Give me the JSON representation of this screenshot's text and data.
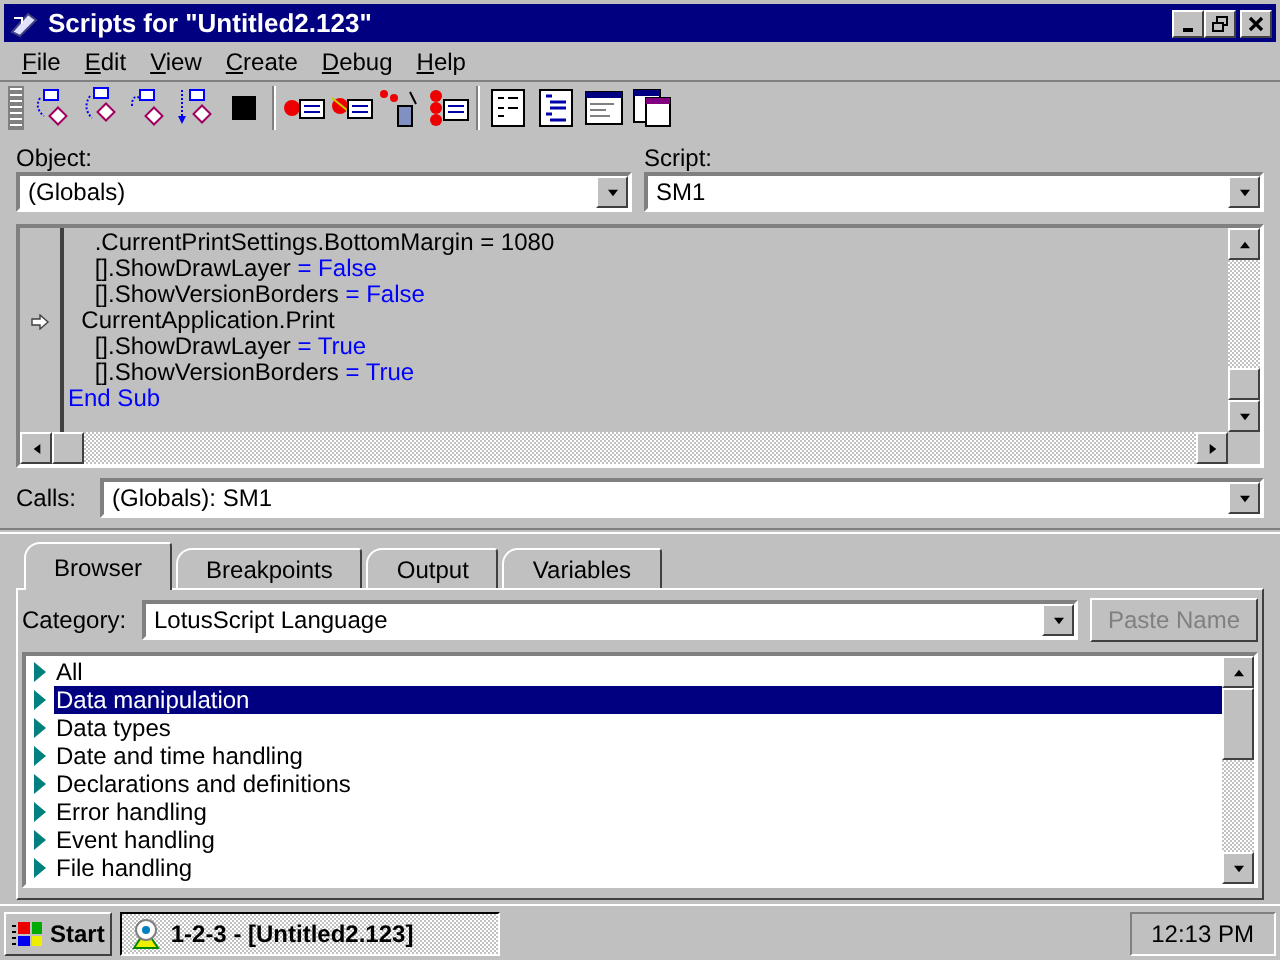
{
  "window": {
    "title": "Scripts for \"Untitled2.123\""
  },
  "menu": [
    "File",
    "Edit",
    "View",
    "Create",
    "Debug",
    "Help"
  ],
  "object": {
    "label": "Object:",
    "value": "(Globals)"
  },
  "script": {
    "label": "Script:",
    "value": "SM1"
  },
  "code": [
    {
      "current": false,
      "segments": [
        {
          "kind": "plain",
          "text": "    .CurrentPrintSettings.BottomMargin = 1080"
        }
      ]
    },
    {
      "current": false,
      "segments": [
        {
          "kind": "plain",
          "text": "    [].ShowDrawLayer "
        },
        {
          "kind": "keyword",
          "text": "= False"
        }
      ]
    },
    {
      "current": false,
      "segments": [
        {
          "kind": "plain",
          "text": "    [].ShowVersionBorders "
        },
        {
          "kind": "keyword",
          "text": "= False"
        }
      ]
    },
    {
      "current": true,
      "segments": [
        {
          "kind": "plain",
          "text": "  CurrentApplication.Print"
        }
      ]
    },
    {
      "current": false,
      "segments": [
        {
          "kind": "plain",
          "text": "    [].ShowDrawLayer "
        },
        {
          "kind": "keyword",
          "text": "= True"
        }
      ]
    },
    {
      "current": false,
      "segments": [
        {
          "kind": "plain",
          "text": "    [].ShowVersionBorders "
        },
        {
          "kind": "keyword",
          "text": "= True"
        }
      ]
    },
    {
      "current": false,
      "segments": [
        {
          "kind": "keyword",
          "text": "End Sub"
        }
      ]
    }
  ],
  "calls": {
    "label": "Calls:",
    "value": "(Globals): SM1"
  },
  "tabs": [
    {
      "label": "Browser",
      "selected": true
    },
    {
      "label": "Breakpoints",
      "selected": false
    },
    {
      "label": "Output",
      "selected": false
    },
    {
      "label": "Variables",
      "selected": false
    }
  ],
  "category": {
    "label": "Category:",
    "value": "LotusScript Language"
  },
  "paste_button": {
    "label": "Paste Name",
    "disabled": true
  },
  "browser_items": [
    {
      "label": "All",
      "selected": false
    },
    {
      "label": "Data manipulation",
      "selected": true
    },
    {
      "label": "Data types",
      "selected": false
    },
    {
      "label": "Date and time handling",
      "selected": false
    },
    {
      "label": "Declarations and definitions",
      "selected": false
    },
    {
      "label": "Error handling",
      "selected": false
    },
    {
      "label": "Event handling",
      "selected": false
    },
    {
      "label": "File handling",
      "selected": false
    }
  ],
  "taskbar": {
    "start": "Start",
    "tasks": [
      {
        "label": "1-2-3 - [Untitled2.123]",
        "selected": true
      }
    ],
    "clock": "12:13 PM"
  }
}
